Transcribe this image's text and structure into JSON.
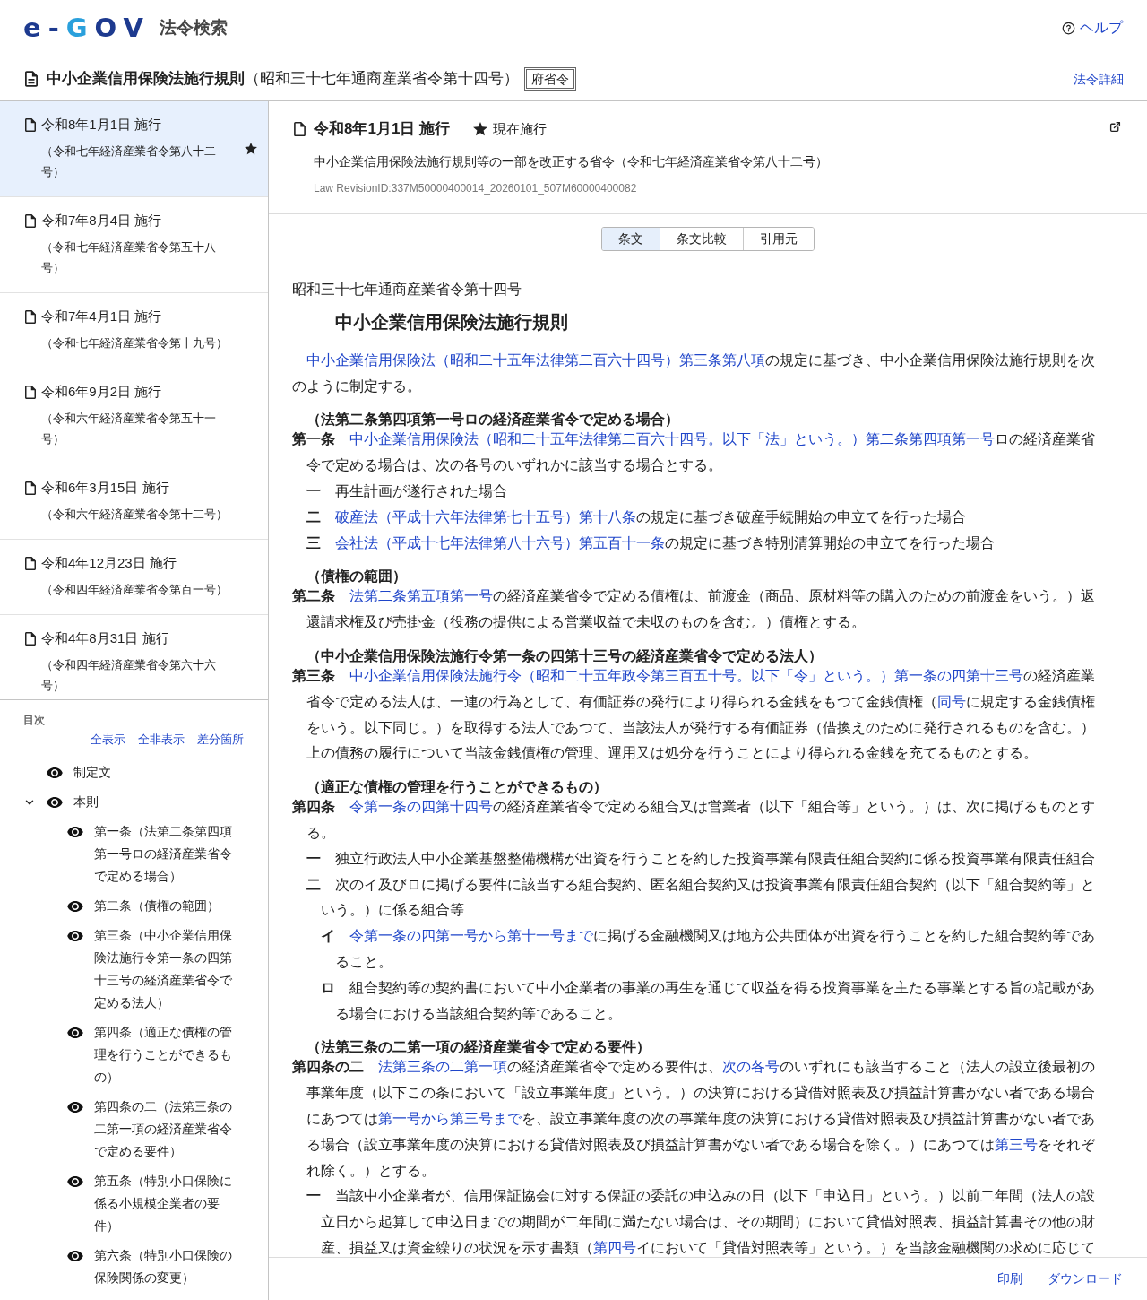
{
  "header": {
    "logo": "e-GOV",
    "site_title": "法令検索",
    "help": "ヘルプ"
  },
  "law": {
    "title": "中小企業信用保険法施行規則",
    "number": "（昭和三十七年通商産業省令第十四号）",
    "type_badge": "府省令",
    "details_link": "法令詳細"
  },
  "revisions": [
    {
      "date": "令和8年1月1日 施行",
      "amending_law": "（令和七年経済産業省令第八十二号）",
      "selected": true,
      "current": true
    },
    {
      "date": "令和7年8月4日 施行",
      "amending_law": "（令和七年経済産業省令第五十八号）",
      "selected": false,
      "current": false
    },
    {
      "date": "令和7年4月1日 施行",
      "amending_law": "（令和七年経済産業省令第十九号）",
      "selected": false,
      "current": false
    },
    {
      "date": "令和6年9月2日 施行",
      "amending_law": "（令和六年経済産業省令第五十一号）",
      "selected": false,
      "current": false
    },
    {
      "date": "令和6年3月15日 施行",
      "amending_law": "（令和六年経済産業省令第十二号）",
      "selected": false,
      "current": false
    },
    {
      "date": "令和4年12月23日 施行",
      "amending_law": "（令和四年経済産業省令第百一号）",
      "selected": false,
      "current": false
    },
    {
      "date": "令和4年8月31日 施行",
      "amending_law": "（令和四年経済産業省令第六十六号）",
      "selected": false,
      "current": false
    }
  ],
  "toc": {
    "heading": "目次",
    "actions": [
      "全表示",
      "全非表示",
      "差分箇所"
    ],
    "items": [
      {
        "label": "制定文"
      },
      {
        "label": "本則",
        "expanded": true,
        "children": [
          {
            "label": "第一条（法第二条第四項第一号ロの経済産業省令で定める場合）"
          },
          {
            "label": "第二条（債権の範囲）"
          },
          {
            "label": "第三条（中小企業信用保険法施行令第一条の四第十三号の経済産業省令で定める法人）"
          },
          {
            "label": "第四条（適正な債権の管理を行うことができるもの）"
          },
          {
            "label": "第四条の二（法第三条の二第一項の経済産業省令で定める要件）"
          },
          {
            "label": "第五条（特別小口保険に係る小規模企業者の要件）"
          },
          {
            "label": "第六条（特別小口保険の保険関係の変更）"
          }
        ]
      }
    ]
  },
  "revision_info": {
    "date": "令和8年1月1日 施行",
    "status": "現在施行",
    "amending_law": "中小企業信用保険法施行規則等の一部を改正する省令（令和七年経済産業省令第八十二号）",
    "revision_id": "Law RevisionID:337M50000400014_20260101_507M60000400082"
  },
  "view_tabs": [
    {
      "label": "条文",
      "selected": true
    },
    {
      "label": "条文比較",
      "selected": false
    },
    {
      "label": "引用元",
      "selected": false
    }
  ],
  "law_text": {
    "law_number": "昭和三十七年通商産業省令第十四号",
    "title": "中小企業信用保険法施行規則",
    "enactment": [
      {
        "text": "中小企業信用保険法（昭和二十五年法律第二百六十四号）",
        "link": true
      },
      {
        "text": "第三条第八項",
        "link": true
      },
      {
        "text": "の規定に基づき、中小企業信用保険法施行規則を次のように制定する。",
        "link": false
      }
    ],
    "articles": [
      {
        "caption": "（法第二条第四項第一号ロの経済産業省令で定める場合）",
        "number": "第一条",
        "segments": [
          {
            "text": "中小企業信用保険法（昭和二十五年法律第二百六十四号。以下「法」という。）",
            "link": true
          },
          {
            "text": "第二条第四項第一号",
            "link": true
          },
          {
            "text": "ロの経済産業省令で定める場合は、次の各号のいずれかに該当する場合とする。",
            "link": false
          }
        ],
        "items": [
          {
            "number": "一",
            "segments": [
              {
                "text": "再生計画が遂行された場合",
                "link": false
              }
            ]
          },
          {
            "number": "二",
            "segments": [
              {
                "text": "破産法（平成十六年法律第七十五号）",
                "link": true
              },
              {
                "text": "第十八条",
                "link": true
              },
              {
                "text": "の規定に基づき破産手続開始の申立てを行った場合",
                "link": false
              }
            ]
          },
          {
            "number": "三",
            "segments": [
              {
                "text": "会社法（平成十七年法律第八十六号）",
                "link": true
              },
              {
                "text": "第五百十一条",
                "link": true
              },
              {
                "text": "の規定に基づき特別清算開始の申立てを行った場合",
                "link": false
              }
            ]
          }
        ]
      },
      {
        "caption": "（債権の範囲）",
        "number": "第二条",
        "segments": [
          {
            "text": "法第二条第五項第一号",
            "link": true
          },
          {
            "text": "の経済産業省令で定める債権は、前渡金（商品、原材料等の購入のための前渡金をいう。）返還請求権及び売掛金（役務の提供による営業収益で未収のものを含む。）債権とする。",
            "link": false
          }
        ]
      },
      {
        "caption": "（中小企業信用保険法施行令第一条の四第十三号の経済産業省令で定める法人）",
        "number": "第三条",
        "segments": [
          {
            "text": "中小企業信用保険法施行令（昭和二十五年政令第三百五十号。以下「令」という。）",
            "link": true
          },
          {
            "text": "第一条の四第十三号",
            "link": true
          },
          {
            "text": "の経済産業省令で定める法人は、一連の行為として、有価証券の発行により得られる金銭をもつて金銭債権（",
            "link": false
          },
          {
            "text": "同号",
            "link": true
          },
          {
            "text": "に規定する金銭債権をいう。以下同じ。）を取得する法人であつて、当該法人が発行する有価証券（借換えのために発行されるものを含む。）上の債務の履行について当該金銭債権の管理、運用又は処分を行うことにより得られる金銭を充てるものとする。",
            "link": false
          }
        ]
      },
      {
        "caption": "（適正な債権の管理を行うことができるもの）",
        "number": "第四条",
        "segments": [
          {
            "text": "令第一条の四第十四号",
            "link": true
          },
          {
            "text": "の経済産業省令で定める組合又は営業者（以下「組合等」という。）は、次に掲げるものとする。",
            "link": false
          }
        ],
        "items": [
          {
            "number": "一",
            "segments": [
              {
                "text": "独立行政法人中小企業基盤整備機構が出資を行うことを約した投資事業有限責任組合契約に係る投資事業有限責任組合",
                "link": false
              }
            ]
          },
          {
            "number": "二",
            "segments": [
              {
                "text": "次のイ及びロに掲げる要件に該当する組合契約、匿名組合契約又は投資事業有限責任組合契約（以下「組合契約等」という。）に係る組合等",
                "link": false
              }
            ],
            "subitems": [
              {
                "number": "イ",
                "segments": [
                  {
                    "text": "令第一条の四第一号から第十一号まで",
                    "link": true
                  },
                  {
                    "text": "に掲げる金融機関又は地方公共団体が出資を行うことを約した組合契約等であること。",
                    "link": false
                  }
                ]
              },
              {
                "number": "ロ",
                "segments": [
                  {
                    "text": "組合契約等の契約書において中小企業者の事業の再生を通じて収益を得る投資事業を主たる事業とする旨の記載がある場合における当該組合契約等であること。",
                    "link": false
                  }
                ]
              }
            ]
          }
        ]
      },
      {
        "caption": "（法第三条の二第一項の経済産業省令で定める要件）",
        "number": "第四条の二",
        "segments": [
          {
            "text": "法第三条の二第一項",
            "link": true
          },
          {
            "text": "の経済産業省令で定める要件は、",
            "link": false
          },
          {
            "text": "次の各号",
            "link": true
          },
          {
            "text": "のいずれにも該当すること（法人の設立後最初の事業年度（以下この条において「設立事業年度」という。）の決算における貸借対照表及び損益計算書がない者である場合にあつては",
            "link": false
          },
          {
            "text": "第一号から第三号まで",
            "link": true
          },
          {
            "text": "を、設立事業年度の次の事業年度の決算における貸借対照表及び損益計算書がない者である場合（設立事業年度の決算における貸借対照表及び損益計算書がない者である場合を除く。）にあつては",
            "link": false
          },
          {
            "text": "第三号",
            "link": true
          },
          {
            "text": "をそれぞれ除く。）とする。",
            "link": false
          }
        ],
        "items": [
          {
            "number": "一",
            "segments": [
              {
                "text": "当該中小企業者が、信用保証協会に対する保証の委託の申込みの日（以下「申込日」という。）以前二年間（法人の設立日から起算して申込日までの期間が二年間に満たない場合は、その期間）において貸借対照表、損益計算書その他の財産、損益又は資金繰りの状況を示す書類（",
                "link": false
              },
              {
                "text": "第四号",
                "link": true
              },
              {
                "text": "イにおいて「貸借対照表等」という。）を当該金融機関の求めに応じて",
                "link": false
              }
            ]
          }
        ]
      }
    ]
  },
  "footer_links": [
    "印刷",
    "ダウンロード"
  ]
}
